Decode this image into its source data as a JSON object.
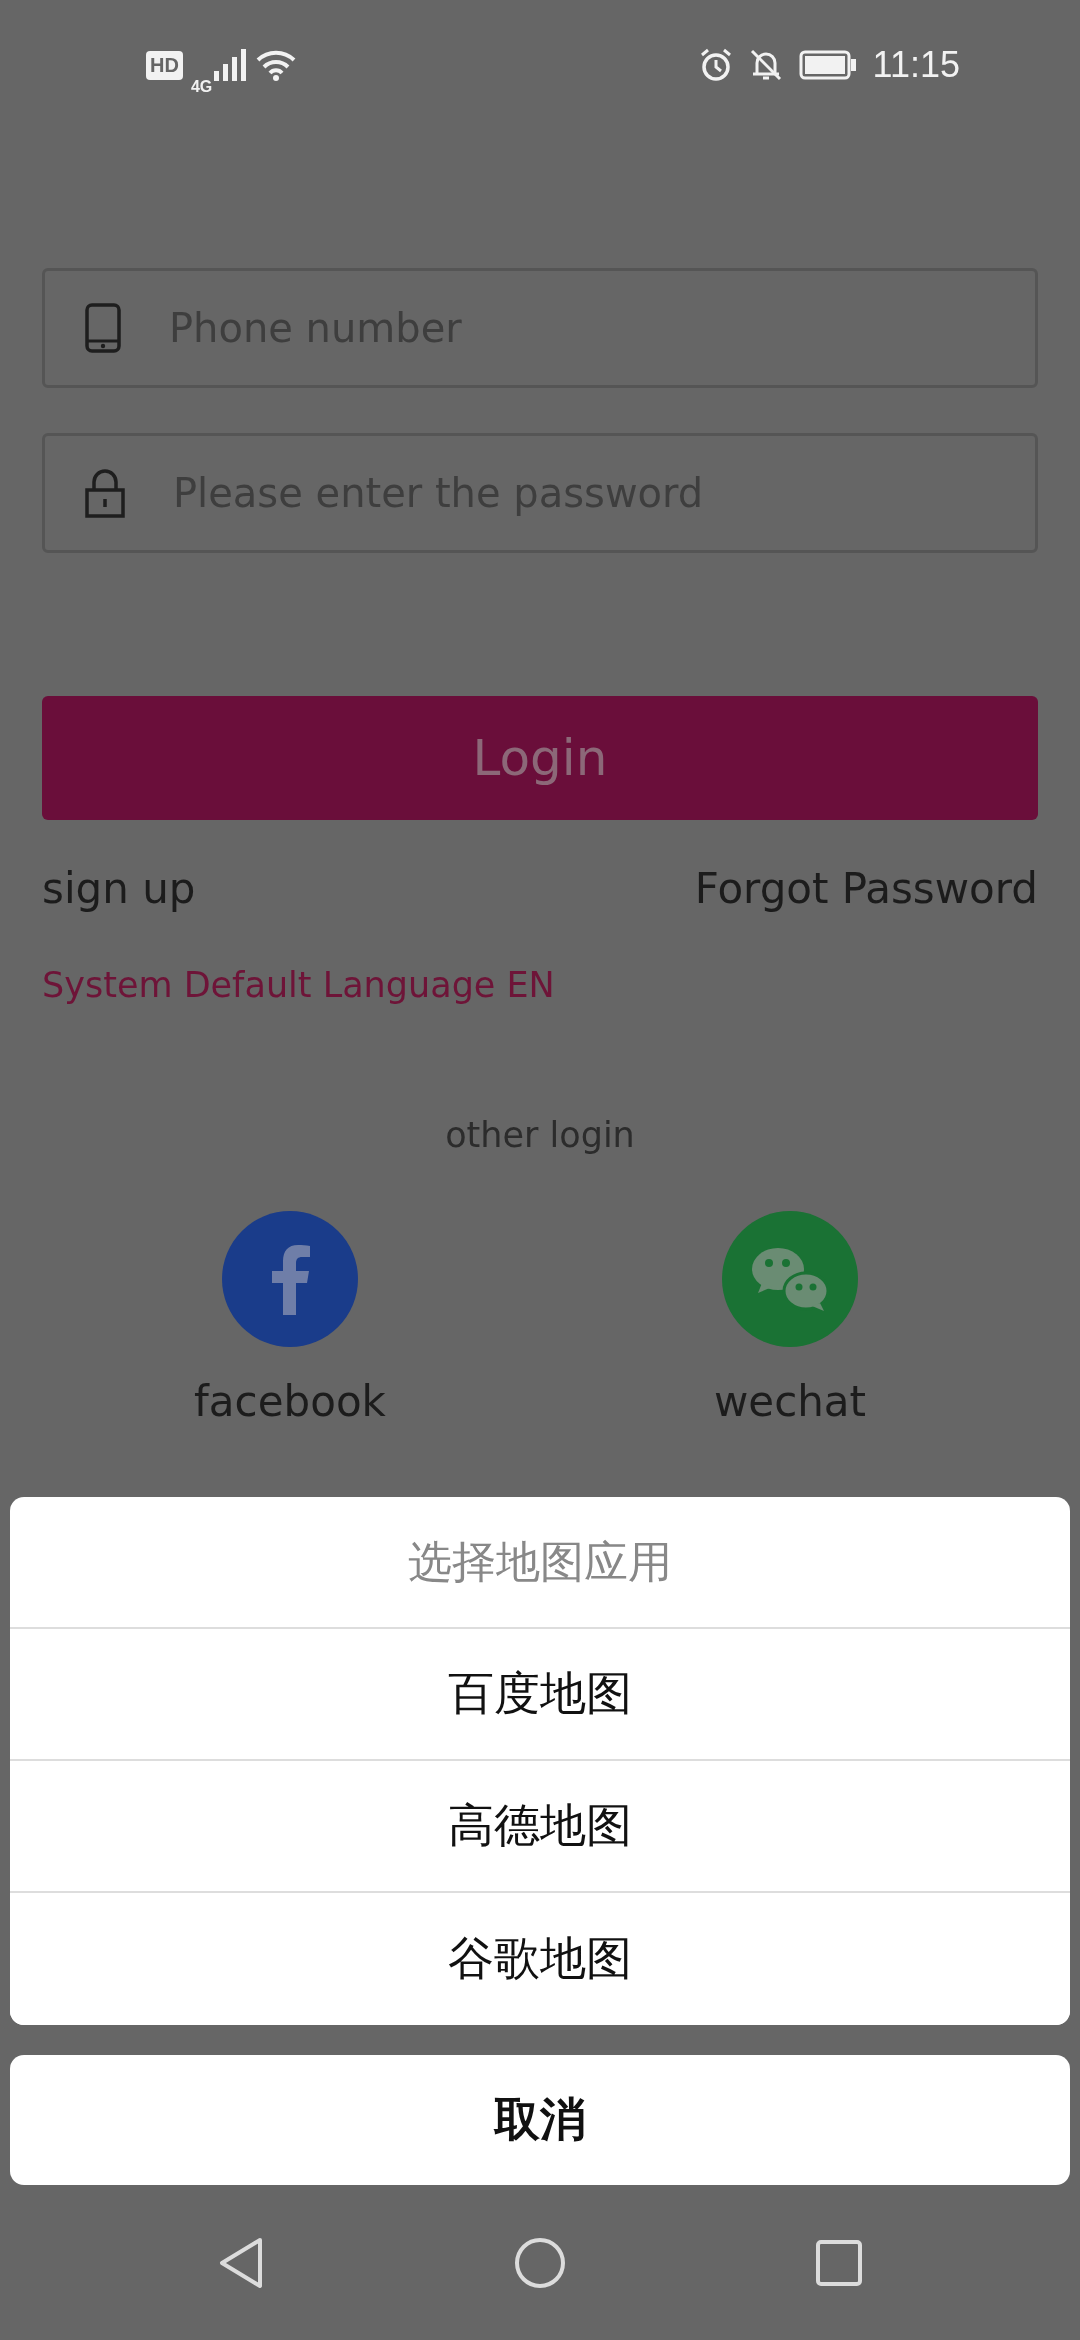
{
  "status_bar": {
    "hd_badge": "HD",
    "network": "4G",
    "time": "11:15"
  },
  "login_form": {
    "phone_field": {
      "placeholder": "Phone number"
    },
    "password_field": {
      "placeholder": "Please enter the password"
    },
    "login_button": "Login",
    "sign_up_link": "sign up",
    "forgot_password_link": "Forgot Password",
    "language_link": "System Default Language EN"
  },
  "other_login": {
    "title": "other login",
    "providers": [
      {
        "kind": "facebook",
        "label": "facebook",
        "color": "#1a3c8a"
      },
      {
        "kind": "wechat",
        "label": "wechat",
        "color": "#1a7234"
      }
    ]
  },
  "action_sheet": {
    "title": "选择地图应用",
    "options": [
      "百度地图",
      "高德地图",
      "谷歌地图"
    ],
    "cancel": "取消"
  }
}
